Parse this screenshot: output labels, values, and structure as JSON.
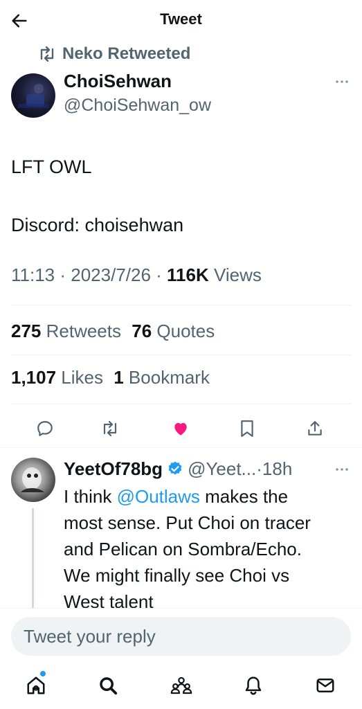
{
  "header": {
    "title": "Tweet",
    "back_icon": "back-arrow-icon"
  },
  "retweet_context": {
    "icon": "retweet-icon",
    "label": "Neko Retweeted"
  },
  "tweet": {
    "author_name": "ChoiSehwan",
    "author_handle": "@ChoiSehwan_ow",
    "text_line1": "LFT OWL",
    "text_line2": "Discord: choisehwan",
    "time": "11:13",
    "sep1": " · ",
    "date": "2023/7/26",
    "sep2": " · ",
    "views_count": "116K",
    "views_label": " Views",
    "retweets_count": "275",
    "retweets_label": " Retweets",
    "quotes_count": "76",
    "quotes_label": " Quotes",
    "likes_count": "1,107",
    "likes_label": " Likes",
    "bookmarks_count": "1",
    "bookmarks_label": " Bookmark"
  },
  "actions": {
    "icons": [
      "reply-icon",
      "retweet-icon",
      "heart-icon",
      "bookmark-icon",
      "share-icon"
    ],
    "like_color": "#f91880"
  },
  "reply": {
    "author_name": "YeetOf78bg",
    "author_handle": "@Yeet...",
    "sep": "·",
    "time": "18h",
    "line1_pre": "I think ",
    "line1_mention": "@Outlaws",
    "line1_post": " makes the",
    "line2": "most sense. Put Choi on tracer",
    "line3": "and Pelican on Sombra/Echo.",
    "line4": "We might finally see Choi vs",
    "line5": "West talent"
  },
  "composer": {
    "placeholder": "Tweet your reply"
  },
  "tab_bar": {
    "icons": [
      "home-icon",
      "search-icon",
      "communities-icon",
      "notifications-icon",
      "messages-icon"
    ]
  },
  "colors": {
    "accent": "#1d9bf0",
    "secondary_text": "#536471",
    "verified": "#1d9bf0",
    "like": "#f91880"
  }
}
